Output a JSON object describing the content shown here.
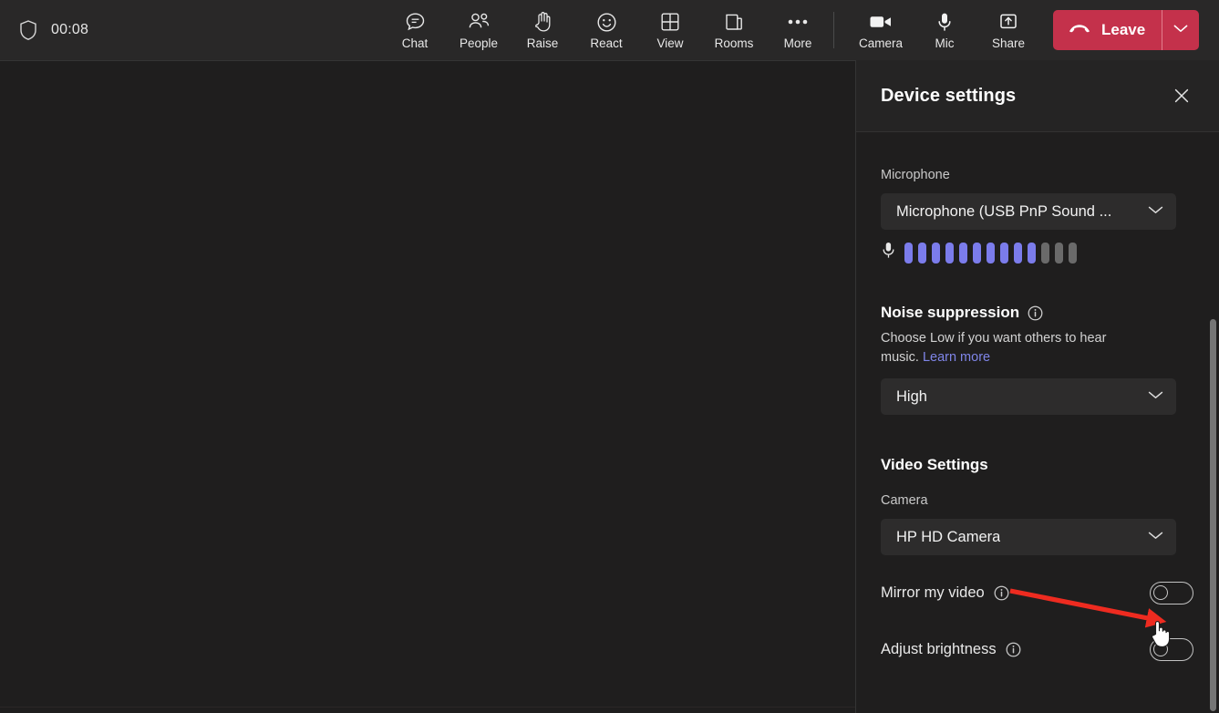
{
  "meeting": {
    "shield_icon": "shield-icon",
    "timer": "00:08"
  },
  "toolbar": {
    "items": [
      {
        "label": "Chat",
        "icon": "chat-icon"
      },
      {
        "label": "People",
        "icon": "people-icon"
      },
      {
        "label": "Raise",
        "icon": "raise-hand-icon"
      },
      {
        "label": "React",
        "icon": "react-smiley-icon"
      },
      {
        "label": "View",
        "icon": "view-grid-icon"
      },
      {
        "label": "Rooms",
        "icon": "breakout-rooms-icon"
      },
      {
        "label": "More",
        "icon": "more-ellipsis-icon"
      }
    ],
    "media": [
      {
        "label": "Camera",
        "icon": "camera-icon"
      },
      {
        "label": "Mic",
        "icon": "microphone-icon"
      },
      {
        "label": "Share",
        "icon": "share-screen-icon"
      }
    ],
    "leave": {
      "label": "Leave",
      "icon": "hangup-phone-icon",
      "caret_icon": "chevron-down-icon",
      "color": "#c4314b"
    }
  },
  "panel": {
    "title": "Device settings",
    "close_icon": "close-icon",
    "microphone": {
      "label": "Microphone",
      "selected": "Microphone (USB PnP Sound ...",
      "caret_icon": "chevron-down-icon",
      "meter_icon": "microphone-level-icon",
      "meter_total": 13,
      "meter_active": 10,
      "meter_active_color": "#7b7ceb",
      "meter_inactive_color": "#6a6a6a"
    },
    "noise_suppression": {
      "title": "Noise suppression",
      "info_icon": "info-circle-icon",
      "helper_text": "Choose Low if you want others to hear music.",
      "link_text": "Learn more",
      "link_color": "#7f85e8",
      "selected": "High",
      "caret_icon": "chevron-down-icon"
    },
    "video_settings": {
      "title": "Video Settings",
      "camera_label": "Camera",
      "camera_selected": "HP HD Camera",
      "caret_icon": "chevron-down-icon",
      "toggles": [
        {
          "label": "Mirror my video",
          "info_icon": "info-circle-icon",
          "state": "off"
        },
        {
          "label": "Adjust brightness",
          "info_icon": "info-circle-icon",
          "state": "off"
        }
      ]
    }
  },
  "annotation": {
    "arrow_color": "#ee2b20",
    "arrow_name": "red-pointer-arrow",
    "cursor_name": "hand-pointer-cursor"
  },
  "scrollbar": {
    "name": "panel-scrollbar",
    "thumb_color": "#757575"
  }
}
